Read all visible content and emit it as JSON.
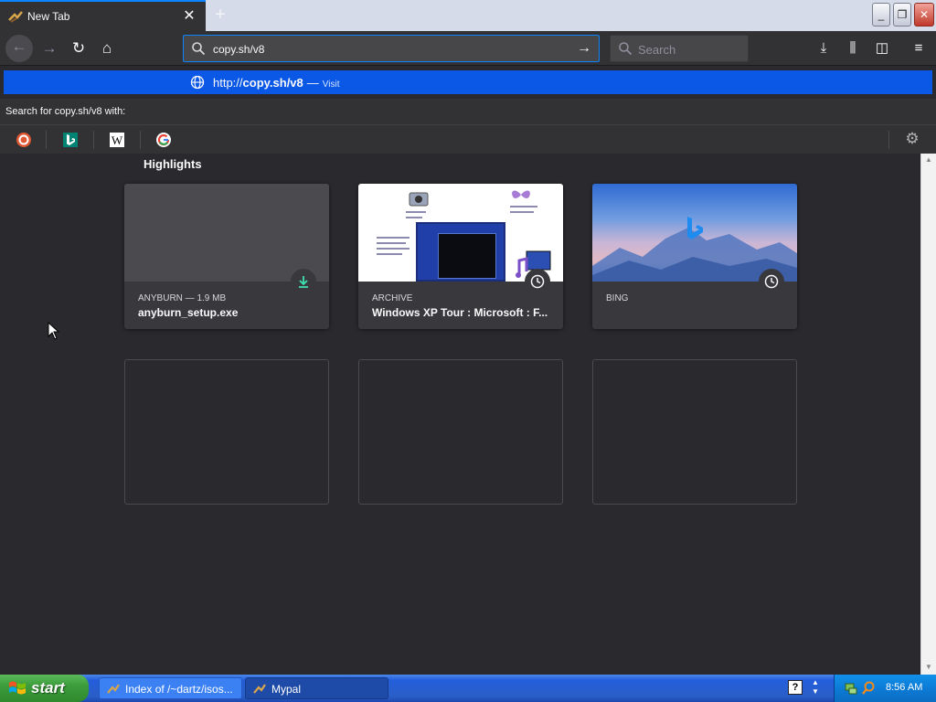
{
  "browser": {
    "tab": {
      "title": "New Tab",
      "close_glyph": "✕"
    },
    "new_tab_glyph": "+",
    "window_controls": {
      "minimize": "_",
      "maximize": "❐",
      "close": "✕"
    }
  },
  "navbar": {
    "url_value": "copy.sh/v8",
    "search_placeholder": "Search",
    "icons": {
      "back": "back-arrow-icon",
      "forward": "forward-arrow-icon",
      "reload": "reload-icon",
      "home": "home-icon",
      "go": "go-arrow-icon",
      "download": "download-icon",
      "library": "library-icon",
      "sidebar": "sidebar-icon",
      "menu": "hamburger-menu-icon"
    }
  },
  "dropdown": {
    "result": {
      "prefix": "http://",
      "domain": "copy.sh/v8",
      "separator": "—",
      "action": "Visit"
    },
    "search_for_label": "Search for copy.sh/v8 with:",
    "engines": [
      "duckduckgo-icon",
      "bing-icon",
      "wikipedia-icon",
      "google-icon"
    ]
  },
  "newtab": {
    "section_title": "Highlights",
    "cards": [
      {
        "context": "ANYBURN — 1.9 MB",
        "title": "anyburn_setup.exe",
        "badge": "download-icon"
      },
      {
        "context": "ARCHIVE",
        "title": "Windows XP Tour : Microsoft : F...",
        "badge": "history-clock-icon"
      },
      {
        "context": "BING",
        "title": "",
        "badge": "history-clock-icon"
      }
    ],
    "empty_slots": 3
  },
  "taskbar": {
    "start_label": "start",
    "tasks": [
      {
        "label": "Index of /~dartz/isos..."
      },
      {
        "label": "Mypal"
      }
    ],
    "clock": "8:56 AM"
  },
  "colors": {
    "accent": "#0a84ff",
    "highlight_row": "#0a58e5",
    "page_bg": "#2a2a2e",
    "toolbar_bg": "#323234",
    "download_green": "#3fe1b0"
  }
}
